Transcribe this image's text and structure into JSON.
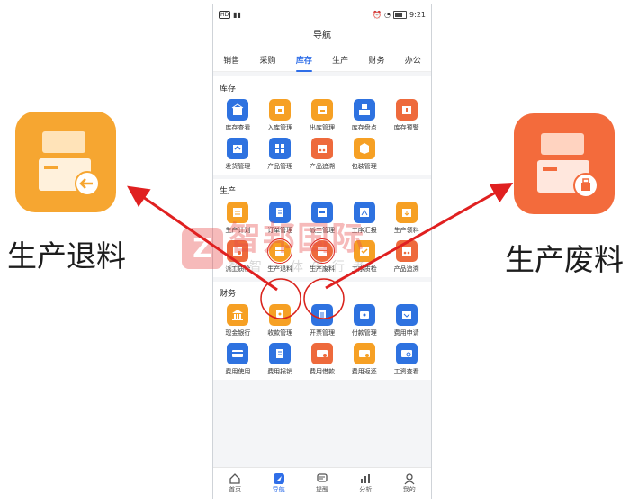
{
  "callouts": {
    "left_label": "生产退料",
    "right_label": "生产废料"
  },
  "status_bar": {
    "time": "9:21"
  },
  "nav": {
    "title": "导航",
    "tabs": [
      "销售",
      "采购",
      "库存",
      "生产",
      "财务",
      "办公"
    ],
    "active_tab": "库存"
  },
  "sections": {
    "inventory": {
      "title": "库存",
      "items": [
        "库存查看",
        "入库管理",
        "出库管理",
        "库存盘点",
        "库存预警",
        "发货管理",
        "产品管理",
        "产品追溯",
        "包装管理"
      ]
    },
    "production": {
      "title": "生产",
      "items": [
        "生产计划",
        "订单管理",
        "派工管理",
        "工序汇报",
        "生产领料",
        "派工质检",
        "生产退料",
        "生产废料",
        "工序质检",
        "产品追溯"
      ]
    },
    "finance": {
      "title": "财务",
      "items": [
        "现金银行",
        "收款管理",
        "开票管理",
        "付款管理",
        "费用申请",
        "费用使用",
        "费用报销",
        "费用借款",
        "费用返还",
        "工资查看"
      ]
    }
  },
  "bottom_nav": [
    "首页",
    "导航",
    "提醒",
    "分析",
    "我的"
  ],
  "watermark": {
    "name": "智邦国际",
    "slogan": "数智一体先行者"
  },
  "colors": {
    "accent_blue": "#2f6ee8",
    "icon_orange": "#f6a024",
    "icon_red": "#ee6a3c",
    "arrow_red": "#e02020"
  }
}
